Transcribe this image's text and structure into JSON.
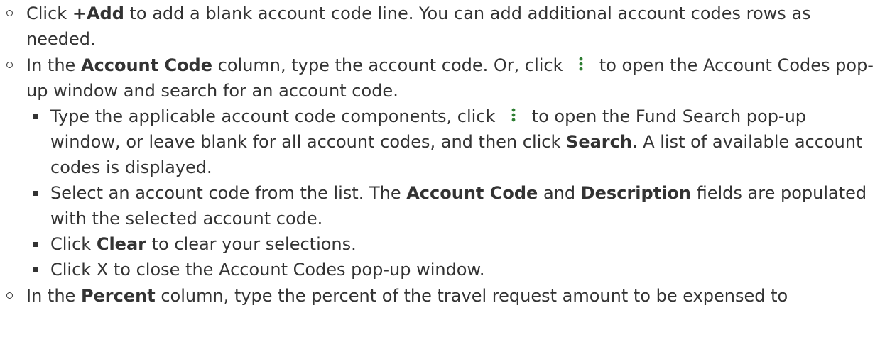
{
  "icons": {
    "kebab": "kebab-menu-icon",
    "kebab_color": "#2e7d32"
  },
  "items": [
    {
      "p1": "Click ",
      "b1": "+Add",
      "p2": " to add a blank account code line. You can add additional account codes rows as needed."
    },
    {
      "p1": "In the ",
      "b1": "Account Code",
      "p2": " column, type the account code. Or, click ",
      "p3": " to open the Account Codes pop-up window and search for an account code.",
      "sub": [
        {
          "p1": "Type the applicable account code components, click ",
          "p2": " to open the Fund Search pop-up window, or leave blank for all account codes, and then click ",
          "b1": "Search",
          "p3": ". A list of available account codes is displayed."
        },
        {
          "p1": "Select an account code from the list. The ",
          "b1": "Account Code",
          "p2": " and ",
          "b2": "Description",
          "p3": " fields are populated with the selected account code."
        },
        {
          "p1": "Click ",
          "b1": "Clear",
          "p2": " to clear your selections."
        },
        {
          "p1": "Click X to close the Account Codes pop-up window."
        }
      ]
    },
    {
      "p1": "In the ",
      "b1": "Percent",
      "p2": " column, type the percent of the travel request amount to be expensed to"
    }
  ]
}
